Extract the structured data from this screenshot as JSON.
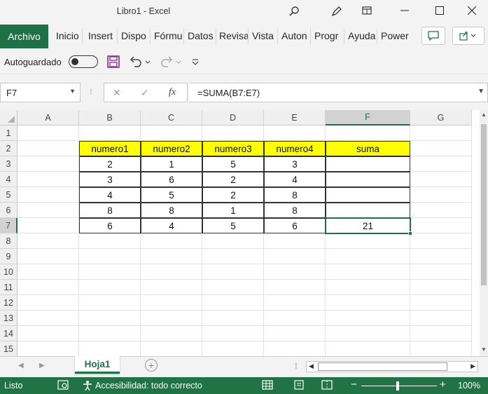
{
  "window": {
    "title": "Libro1  -  Excel"
  },
  "ribbon": {
    "file_tab": "Archivo",
    "tabs": [
      "Inicio",
      "Insert",
      "Dispo",
      "Fórmu",
      "Datos",
      "Revisa",
      "Vista",
      "Auton",
      "Progr",
      "Ayuda",
      "Power"
    ]
  },
  "qat": {
    "autosave_label": "Autoguardado"
  },
  "formula_bar": {
    "name_box": "F7",
    "formula": "=SUMA(B7:E7)",
    "fx": "fx"
  },
  "columns": [
    "A",
    "B",
    "C",
    "D",
    "E",
    "F",
    "G"
  ],
  "rows": [
    "1",
    "2",
    "3",
    "4",
    "5",
    "6",
    "7",
    "8",
    "9",
    "10",
    "11",
    "12",
    "13",
    "14",
    "15"
  ],
  "table": {
    "headers": [
      "numero1",
      "numero2",
      "numero3",
      "numero4",
      "suma"
    ],
    "rows": [
      [
        "2",
        "1",
        "5",
        "3",
        ""
      ],
      [
        "3",
        "6",
        "2",
        "4",
        ""
      ],
      [
        "4",
        "5",
        "2",
        "8",
        ""
      ],
      [
        "8",
        "8",
        "1",
        "8",
        ""
      ],
      [
        "6",
        "4",
        "5",
        "6",
        "21"
      ]
    ]
  },
  "sheets": {
    "active": "Hoja1"
  },
  "status": {
    "ready": "Listo",
    "accessibility": "Accesibilidad: todo correcto",
    "zoom": "100%"
  },
  "icons": [
    "search-icon",
    "pen-icon",
    "ribbon-display-icon",
    "minimize-icon",
    "maximize-icon",
    "close-icon",
    "comment-icon",
    "share-icon",
    "save-icon",
    "undo-icon",
    "redo-icon",
    "customize-icon"
  ],
  "colors": {
    "accent": "#1e7145",
    "status_bar": "#217346",
    "header_fill": "#ffff00"
  }
}
